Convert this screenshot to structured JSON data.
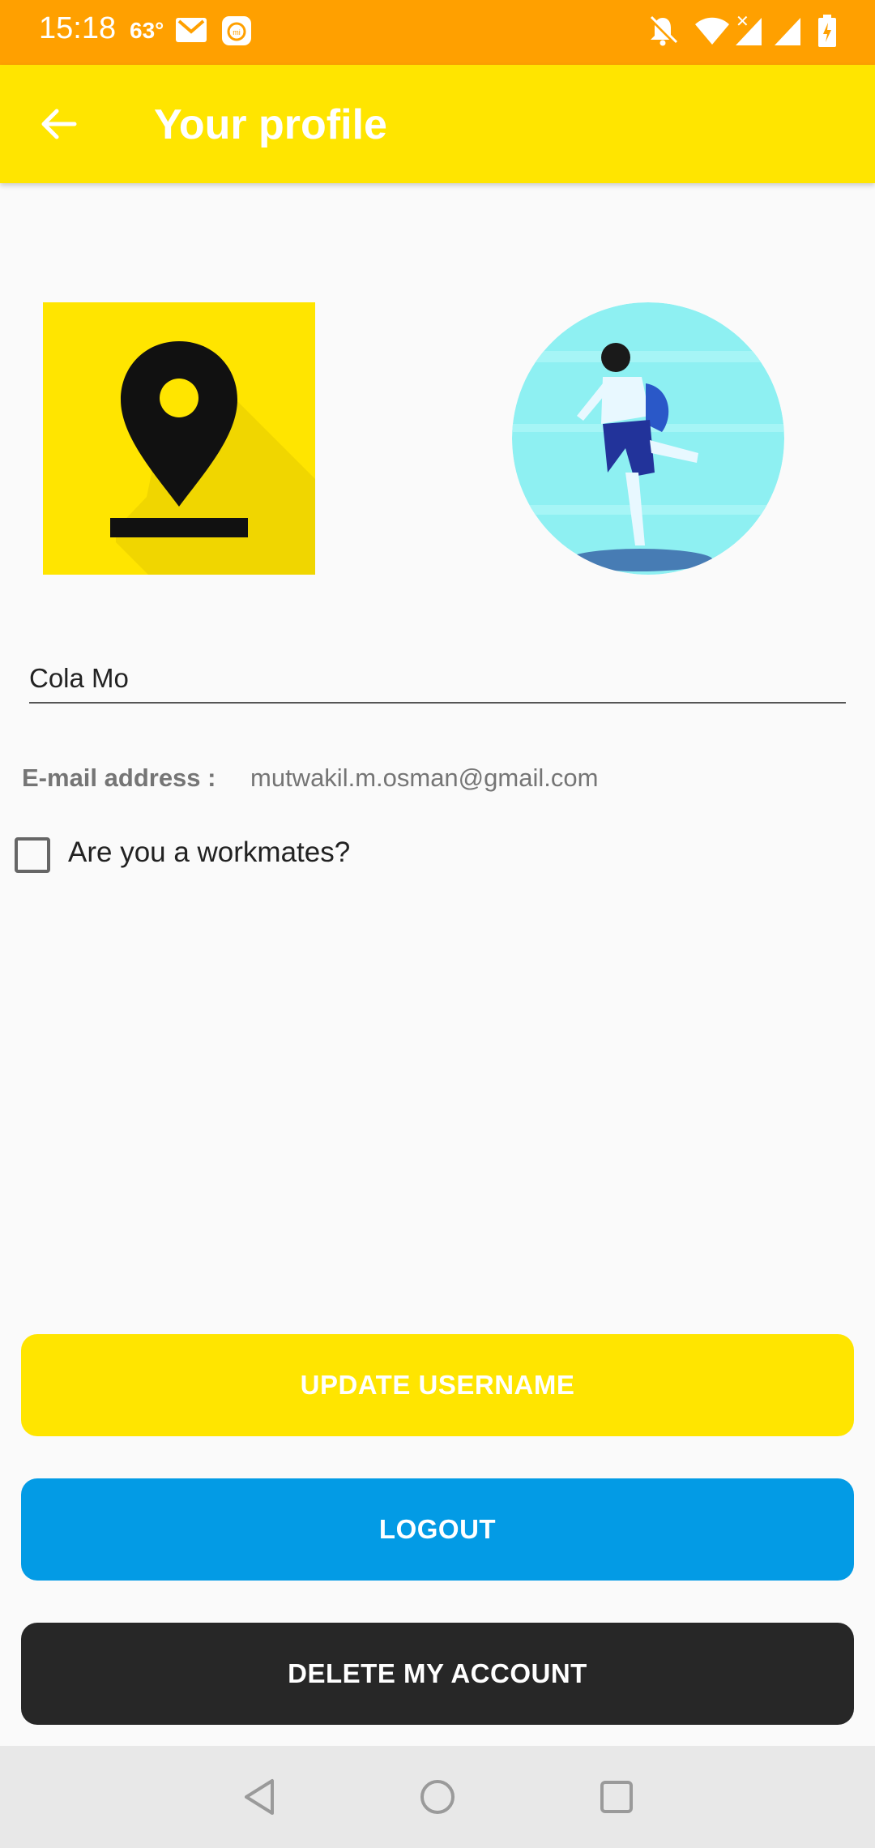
{
  "status_bar": {
    "time": "15:18",
    "temperature": "63°",
    "background_color": "#ffa000",
    "icons": [
      "gmail-icon",
      "mi-app-icon",
      "notifications-off-icon",
      "wifi-icon",
      "signal-icon",
      "signal-icon",
      "battery-icon"
    ]
  },
  "toolbar": {
    "title": "Your profile",
    "back_icon": "arrow-back-icon",
    "background_color": "#ffe500"
  },
  "profile": {
    "logo_icon": "map-pin-icon",
    "avatar_icon": "user-photo",
    "username": "Cola Mo",
    "email_label": "E-mail address :",
    "email": "mutwakil.m.osman@gmail.com",
    "workmate_label": "Are you a workmates?",
    "workmate_checked": false
  },
  "buttons": {
    "update_label": "UPDATE USERNAME",
    "logout_label": "LOGOUT",
    "delete_label": "DELETE MY ACCOUNT",
    "update_color": "#ffe500",
    "logout_color": "#039be5",
    "delete_color": "#272727"
  },
  "nav_bar": {
    "icons": [
      "back-triangle-icon",
      "home-circle-icon",
      "recents-square-icon"
    ]
  }
}
